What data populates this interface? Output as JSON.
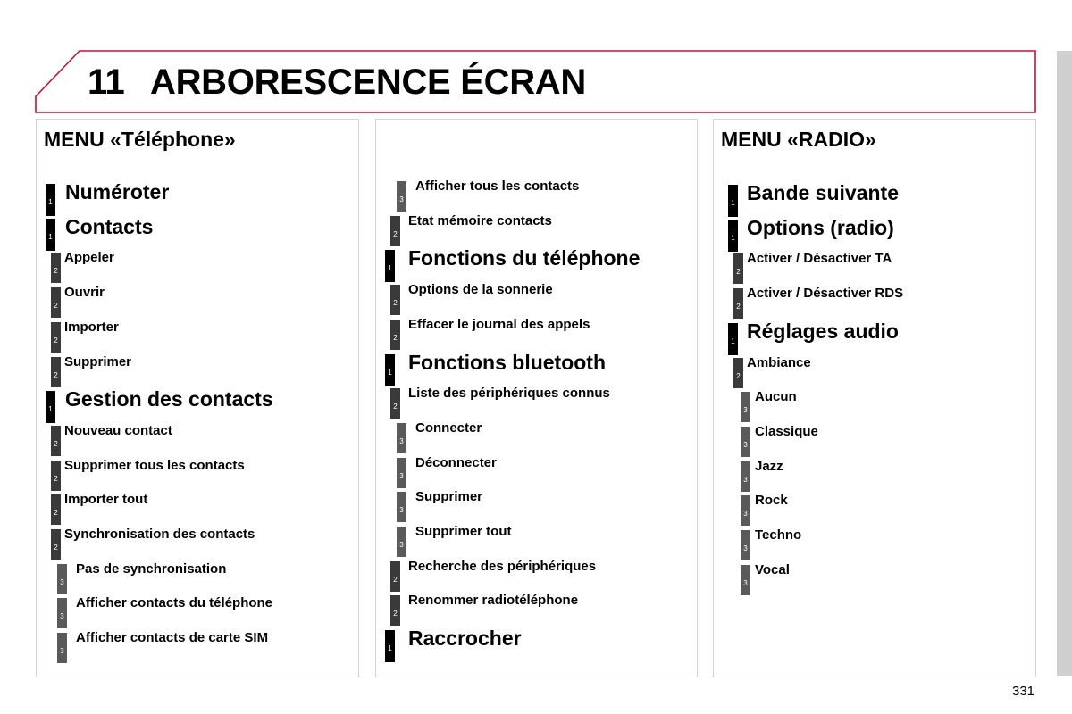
{
  "header": {
    "chapter_number": "11",
    "title": "ARBORESCENCE ÉCRAN",
    "accent_color": "#c8102e"
  },
  "panels": [
    {
      "title": "MENU «Téléphone»",
      "items": [
        {
          "level": 1,
          "label": "Numéroter"
        },
        {
          "level": 1,
          "label": "Contacts"
        },
        {
          "level": 2,
          "label": "Appeler"
        },
        {
          "level": 2,
          "label": "Ouvrir"
        },
        {
          "level": 2,
          "label": "Importer"
        },
        {
          "level": 2,
          "label": "Supprimer"
        },
        {
          "level": 1,
          "label": "Gestion des contacts"
        },
        {
          "level": 2,
          "label": "Nouveau contact"
        },
        {
          "level": 2,
          "label": "Supprimer tous les contacts"
        },
        {
          "level": 2,
          "label": "Importer tout"
        },
        {
          "level": 2,
          "label": "Synchronisation des contacts"
        },
        {
          "level": 3,
          "label": "Pas de synchronisation"
        },
        {
          "level": 3,
          "label": "Afficher contacts du téléphone"
        },
        {
          "level": 3,
          "label": "Afficher contacts de carte SIM"
        }
      ]
    },
    {
      "title": "",
      "items": [
        {
          "level": 3,
          "label": "Afficher tous les contacts"
        },
        {
          "level": 2,
          "label": "Etat mémoire contacts"
        },
        {
          "level": 1,
          "label": "Fonctions du téléphone"
        },
        {
          "level": 2,
          "label": "Options de la sonnerie"
        },
        {
          "level": 2,
          "label": "Effacer le journal des appels"
        },
        {
          "level": 1,
          "label": "Fonctions bluetooth"
        },
        {
          "level": 2,
          "label": "Liste des périphériques connus"
        },
        {
          "level": 3,
          "label": "Connecter"
        },
        {
          "level": 3,
          "label": "Déconnecter"
        },
        {
          "level": 3,
          "label": "Supprimer"
        },
        {
          "level": 3,
          "label": "Supprimer tout"
        },
        {
          "level": 2,
          "label": "Recherche des périphériques"
        },
        {
          "level": 2,
          "label": "Renommer radiotéléphone"
        },
        {
          "level": 1,
          "label": "Raccrocher"
        }
      ]
    },
    {
      "title": "MENU «RADIO»",
      "items": [
        {
          "level": 1,
          "label": "Bande suivante"
        },
        {
          "level": 1,
          "label": "Options (radio)"
        },
        {
          "level": 2,
          "label": "Activer / Désactiver TA"
        },
        {
          "level": 2,
          "label": "Activer / Désactiver RDS"
        },
        {
          "level": 1,
          "label": "Réglages audio"
        },
        {
          "level": 2,
          "label": "Ambiance"
        },
        {
          "level": 3,
          "label": "Aucun"
        },
        {
          "level": 3,
          "label": "Classique"
        },
        {
          "level": 3,
          "label": "Jazz"
        },
        {
          "level": 3,
          "label": "Rock"
        },
        {
          "level": 3,
          "label": "Techno"
        },
        {
          "level": 3,
          "label": "Vocal"
        }
      ]
    }
  ],
  "footer": {
    "page_number": "331"
  }
}
